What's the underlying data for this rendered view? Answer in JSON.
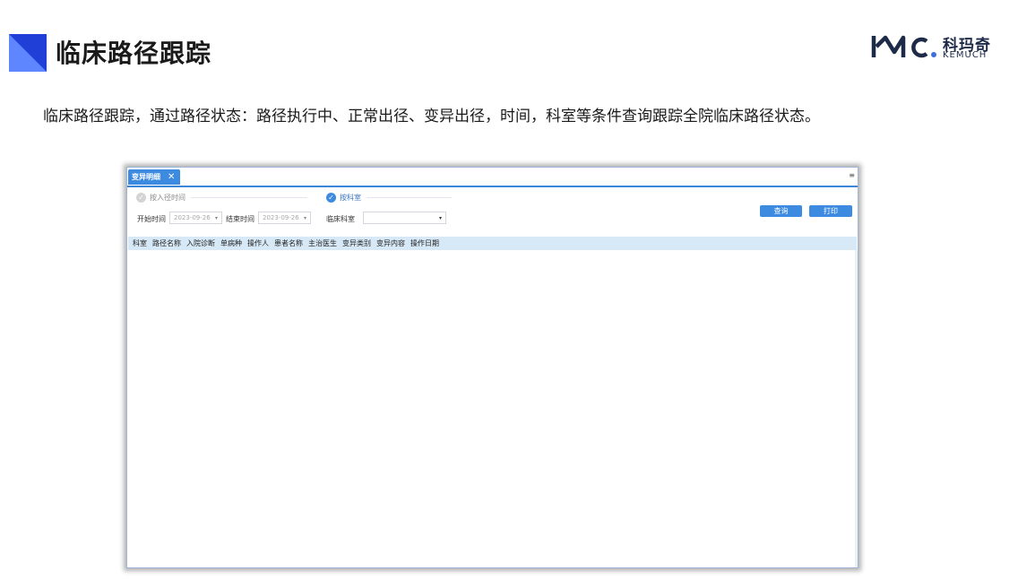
{
  "slide": {
    "title": "临床路径跟踪",
    "description": "临床路径跟踪，通过路径状态：路径执行中、正常出径、变异出径，时间，科室等条件查询跟踪全院临床路径状态。",
    "logo": {
      "cn": "科玛奇",
      "en": "KEMUCH",
      "mark_icon": "kmc-logo-icon"
    }
  },
  "app": {
    "tab": {
      "label": "变异明细",
      "close_glyph": "✕"
    },
    "tab_menu_glyph": "≡",
    "filters": {
      "by_admission": {
        "label": "按入径时间",
        "checked": false
      },
      "by_department": {
        "label": "按科室",
        "checked": true
      },
      "start_label": "开始时间",
      "start_value": "2023-09-26",
      "end_label": "结束时间",
      "end_value": "2023-09-26",
      "dept_label": "临床科室",
      "dept_value": ""
    },
    "buttons": {
      "query": "查询",
      "print": "打印"
    },
    "table": {
      "columns": [
        "科室",
        "路径名称",
        "入院诊断",
        "单病种",
        "操作人",
        "患者名称",
        "主治医生",
        "变异类别",
        "变异内容",
        "操作日期"
      ],
      "rows": []
    }
  },
  "colors": {
    "accent": "#3d8be0",
    "title_block_dark": "#1f3fd6",
    "title_block_light": "#5d86ff",
    "header_row": "#d7e9f7"
  }
}
